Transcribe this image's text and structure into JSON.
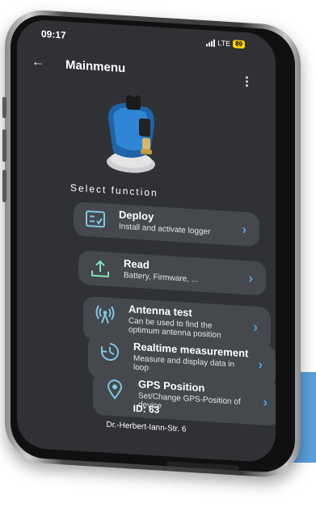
{
  "status": {
    "time": "09:17",
    "network": "LTE",
    "battery": "89"
  },
  "appbar": {
    "title": "Mainmenu",
    "back_icon": "arrow-left-icon",
    "menu_icon": "more-vert-icon"
  },
  "section_label": "Select function",
  "menu": [
    {
      "label": "Deploy",
      "description": "Install and activate logger",
      "icon": "checklist-icon"
    },
    {
      "label": "Read",
      "description": "Battery, Firmware, ...",
      "icon": "upload-icon"
    },
    {
      "label": "Antenna test",
      "description": "Can be used to find the optimum antenna position",
      "icon": "antenna-icon"
    },
    {
      "label": "Realtime measurement",
      "description": "Measure and display data in loop",
      "icon": "timer-icon"
    },
    {
      "label": "GPS Position",
      "description": "Set/Change GPS-Position of device",
      "icon": "location-pin-icon"
    }
  ],
  "footer": {
    "id": "ID: 63",
    "address": "Dr.-Herbert-Iann-Str. 6"
  },
  "colors": {
    "accent": "#4fa3e8",
    "screen_bg": "#2f3134",
    "card_bg": "#45484d",
    "backdrop": "#5b9fdc",
    "icon_tint": "#7ec8e3"
  }
}
